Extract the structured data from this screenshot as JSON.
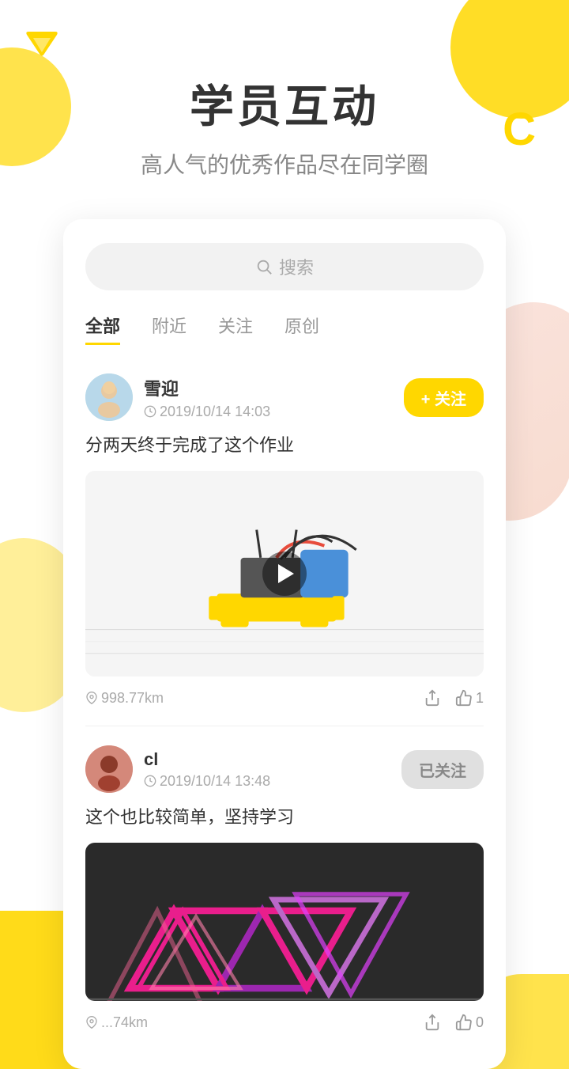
{
  "page": {
    "title": "学员互动",
    "subtitle": "高人气的优秀作品尽在同学圈"
  },
  "search": {
    "placeholder": "搜索"
  },
  "tabs": [
    {
      "id": "all",
      "label": "全部",
      "active": true
    },
    {
      "id": "nearby",
      "label": "附近",
      "active": false
    },
    {
      "id": "follow",
      "label": "关注",
      "active": false
    },
    {
      "id": "original",
      "label": "原创",
      "active": false
    }
  ],
  "posts": [
    {
      "id": 1,
      "username": "雪迎",
      "time": "2019/10/14 14:03",
      "follow_status": "follow",
      "follow_label": "+ 关注",
      "text": "分两天终于完成了这个作业",
      "media_type": "video",
      "location": "998.77km",
      "share_label": "",
      "like_count": "1"
    },
    {
      "id": 2,
      "username": "cl",
      "time": "2019/10/14 13:48",
      "follow_status": "followed",
      "follow_label": "已关注",
      "text": "这个也比较简单，坚持学习",
      "media_type": "image",
      "location": "...74km",
      "share_label": "",
      "like_count": "0"
    }
  ],
  "icons": {
    "search": "🔍",
    "time": "🕐",
    "location": "📍",
    "share": "↗",
    "like": "👍"
  }
}
